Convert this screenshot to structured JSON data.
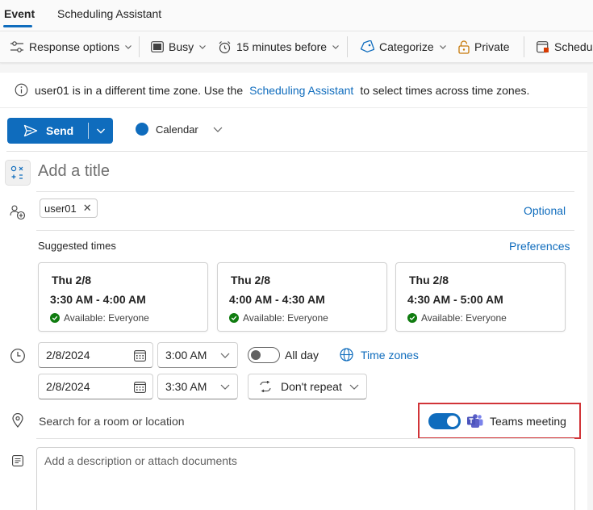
{
  "tabs": [
    {
      "label": "Event"
    },
    {
      "label": "Scheduling Assistant"
    }
  ],
  "toolbar": {
    "response_options": "Response options",
    "busy": "Busy",
    "reminder": "15 minutes before",
    "categorize": "Categorize",
    "private": "Private",
    "scheduling": "Schedul"
  },
  "info": {
    "before": "user01 is in a different time zone. Use the",
    "link": "Scheduling Assistant",
    "after": "to select times across time zones."
  },
  "send": {
    "label": "Send"
  },
  "calendar": {
    "label": "Calendar",
    "color": "#0f6cbd"
  },
  "title": {
    "placeholder": "Add a title"
  },
  "attendees": {
    "chips": [
      {
        "name": "user01"
      }
    ],
    "optional": "Optional"
  },
  "suggested": {
    "label": "Suggested times",
    "preferences": "Preferences",
    "cards": [
      {
        "day": "Thu 2/8",
        "time": "3:30 AM - 4:00 AM",
        "availability": "Available: Everyone"
      },
      {
        "day": "Thu 2/8",
        "time": "4:00 AM - 4:30 AM",
        "availability": "Available: Everyone"
      },
      {
        "day": "Thu 2/8",
        "time": "4:30 AM - 5:00 AM",
        "availability": "Available: Everyone"
      }
    ]
  },
  "schedule": {
    "start_date": "2/8/2024",
    "start_time": "3:00 AM",
    "end_date": "2/8/2024",
    "end_time": "3:30 AM",
    "all_day": "All day",
    "all_day_on": false,
    "time_zones": "Time zones",
    "repeat": "Don't repeat"
  },
  "location": {
    "placeholder": "Search for a room or location",
    "teams_label": "Teams meeting",
    "teams_on": true
  },
  "description": {
    "placeholder": "Add a description or attach documents"
  },
  "colors": {
    "accent": "#0f6cbd",
    "available": "#107c10",
    "highlight_box": "#d13438",
    "teams": "#5b5fc7"
  }
}
